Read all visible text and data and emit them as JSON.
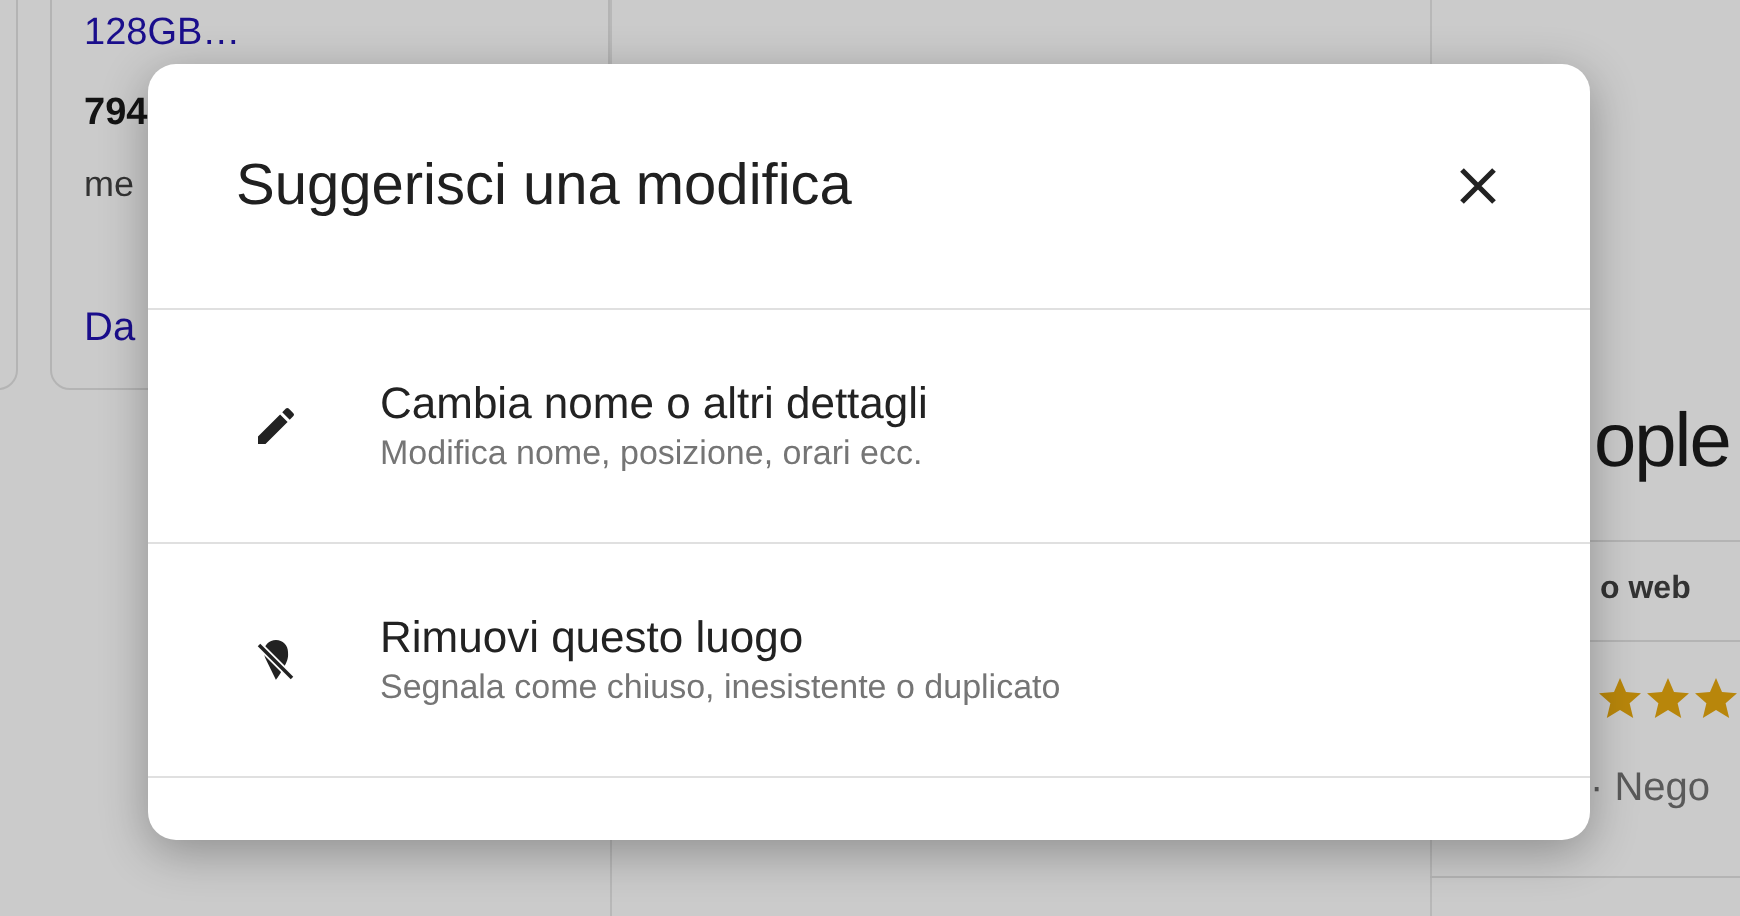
{
  "background": {
    "left_card": {
      "link": "128GB…",
      "price": "794",
      "text": "me",
      "action": "Da"
    },
    "right_panel": {
      "title": "ople",
      "tab": "o web",
      "rating": {
        "stars": 3
      },
      "meta": "·  Nego"
    }
  },
  "dialog": {
    "title": "Suggerisci una modifica",
    "options": [
      {
        "kind": "edit",
        "title": "Cambia nome o altri dettagli",
        "subtitle": "Modifica nome, posizione, orari ecc."
      },
      {
        "kind": "remove",
        "title": "Rimuovi questo luogo",
        "subtitle": "Segnala come chiuso, inesistente o duplicato"
      }
    ]
  }
}
